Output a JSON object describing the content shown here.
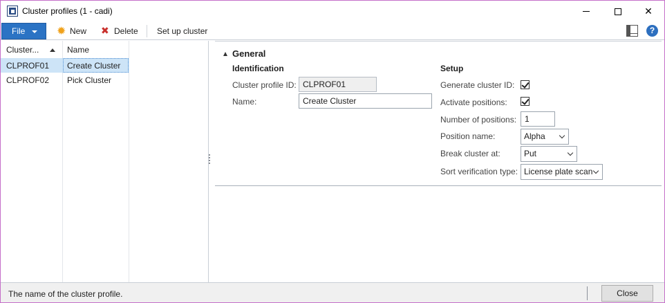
{
  "window": {
    "title": "Cluster profiles (1 - cadi)"
  },
  "toolbar": {
    "file_label": "File",
    "new_label": "New",
    "delete_label": "Delete",
    "setup_label": "Set up cluster"
  },
  "list": {
    "columns": [
      "Cluster...",
      "Name"
    ],
    "rows": [
      {
        "id": "CLPROF01",
        "name": "Create Cluster",
        "selected": true
      },
      {
        "id": "CLPROF02",
        "name": "Pick Cluster",
        "selected": false
      }
    ]
  },
  "general": {
    "section_title": "General",
    "identification": {
      "title": "Identification",
      "profile_id_label": "Cluster profile ID:",
      "profile_id_value": "CLPROF01",
      "name_label": "Name:",
      "name_value": "Create Cluster"
    },
    "setup": {
      "title": "Setup",
      "generate_id_label": "Generate cluster ID:",
      "generate_id_checked": true,
      "activate_positions_label": "Activate positions:",
      "activate_positions_checked": true,
      "num_positions_label": "Number of positions:",
      "num_positions_value": "1",
      "position_name_label": "Position name:",
      "position_name_value": "Alpha",
      "break_cluster_label": "Break cluster at:",
      "break_cluster_value": "Put",
      "sort_verification_label": "Sort verification type:",
      "sort_verification_value": "License plate scan"
    }
  },
  "status": {
    "text": "The name of the cluster profile.",
    "close_label": "Close"
  },
  "colors": {
    "file_button": "#2b73c4",
    "selected_row": "#cde4f7",
    "window_border": "#c46ec9"
  }
}
